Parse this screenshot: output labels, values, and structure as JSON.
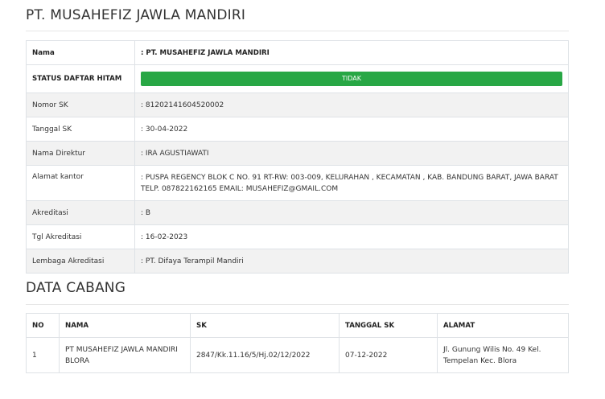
{
  "company": {
    "title": "PT. MUSAHEFIZ JAWLA MANDIRI"
  },
  "info_rows": [
    {
      "label": "Nama",
      "value": ": PT. MUSAHEFIZ JAWLA MANDIRI"
    },
    {
      "label": "STATUS DAFTAR HITAM",
      "value": "TIDAK"
    },
    {
      "label": "Nomor SK",
      "value": ": 81202141604520002"
    },
    {
      "label": "Tanggal SK",
      "value": ": 30-04-2022"
    },
    {
      "label": "Nama Direktur",
      "value": ": IRA AGUSTIAWATI"
    },
    {
      "label": "Alamat kantor",
      "value": ": PUSPA REGENCY BLOK C NO. 91 RT-RW: 003-009, KELURAHAN , KECAMATAN , KAB. BANDUNG BARAT, JAWA BARAT TELP. 087822162165 EMAIL: MUSAHEFIZ@GMAIL.COM"
    },
    {
      "label": "Akreditasi",
      "value": ": B"
    },
    {
      "label": "Tgl Akreditasi",
      "value": ": 16-02-2023"
    },
    {
      "label": "Lembaga Akreditasi",
      "value": ": PT. Difaya Terampil Mandiri"
    }
  ],
  "status_color": "#28a745",
  "branches": {
    "title": "DATA CABANG",
    "headers": [
      "NO",
      "NAMA",
      "SK",
      "TANGGAL SK",
      "ALAMAT"
    ],
    "rows": [
      [
        "1",
        "PT MUSAHEFIZ JAWLA MANDIRI BLORA",
        "2847/Kk.11.16/5/Hj.02/12/2022",
        "07-12-2022",
        "Jl. Gunung Wilis No. 49 Kel. Tempelan Kec. Blora"
      ]
    ]
  }
}
